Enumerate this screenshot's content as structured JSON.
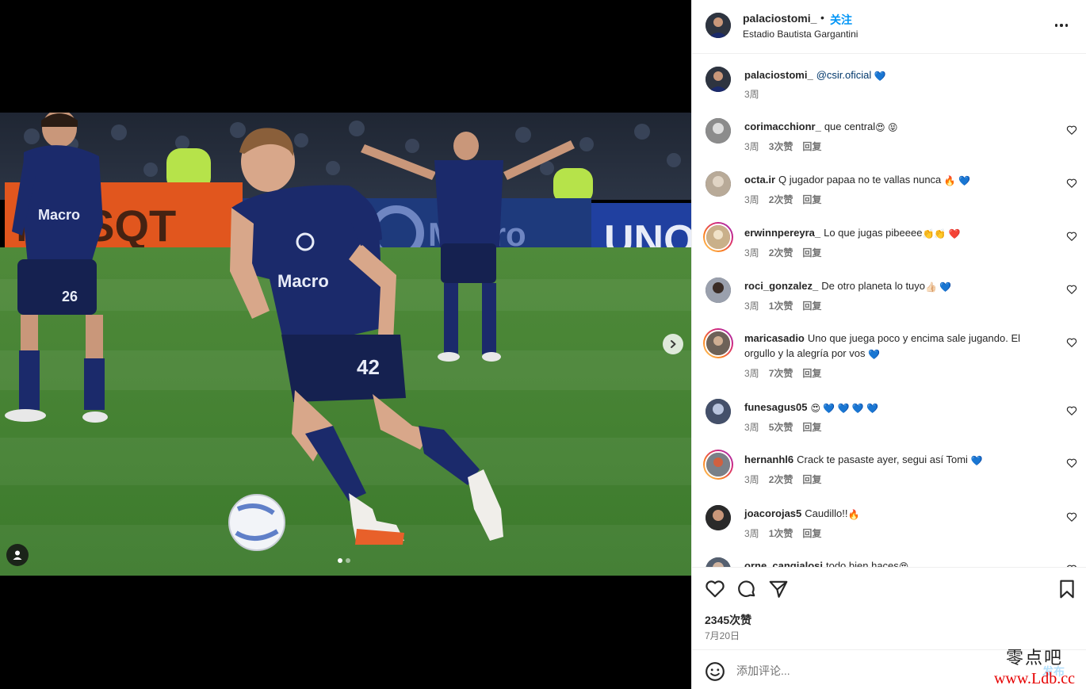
{
  "post": {
    "username": "palaciostomi_",
    "separator": "•",
    "follow_label": "关注",
    "location": "Estadio Bautista Gargantini",
    "more_label": "...",
    "jersey_number_left": "26",
    "jersey_number_main": "42",
    "sponsor_text": "Macro",
    "board_text_1": "MUSQT",
    "board_text_2": "UNO"
  },
  "caption": {
    "username": "palaciostomi_",
    "mention": "@csir.oficial",
    "emoji": "💙",
    "time": "3周"
  },
  "comments": [
    {
      "username": "corimacchionr_",
      "text": "que central",
      "emoji": "😍 😝",
      "time": "3周",
      "likes": "3次赞",
      "reply": "回复",
      "ring": false
    },
    {
      "username": "octa.ir",
      "text": "Q jugador papaa no te vallas nunca",
      "emoji": "🔥 💙",
      "time": "3周",
      "likes": "2次赞",
      "reply": "回复",
      "ring": false
    },
    {
      "username": "erwinnpereyra_",
      "text": "Lo que jugas pibeeee",
      "emoji": "👏👏 ❤️",
      "time": "3周",
      "likes": "2次赞",
      "reply": "回复",
      "ring": true
    },
    {
      "username": "roci_gonzalez_",
      "text": "De otro planeta lo tuyo",
      "emoji": "👍🏻 💙",
      "time": "3周",
      "likes": "1次赞",
      "reply": "回复",
      "ring": false
    },
    {
      "username": "maricasadio",
      "text": "Uno que juega poco y encima sale jugando. El orgullo y la alegría por vos",
      "emoji": "💙",
      "time": "3周",
      "likes": "7次赞",
      "reply": "回复",
      "ring": true
    },
    {
      "username": "funesagus05",
      "text": "",
      "emoji": "😍 💙 💙 💙 💙",
      "time": "3周",
      "likes": "5次赞",
      "reply": "回复",
      "ring": false
    },
    {
      "username": "hernanhl6",
      "text": "Crack te pasaste ayer, segui así Tomi",
      "emoji": "💙",
      "time": "3周",
      "likes": "2次赞",
      "reply": "回复",
      "ring": true
    },
    {
      "username": "joacorojas5",
      "text": "Caudillo!!",
      "emoji": "🔥",
      "time": "3周",
      "likes": "1次赞",
      "reply": "回复",
      "ring": false
    },
    {
      "username": "orne_cangialosi",
      "text": "todo bien haces",
      "emoji": "😍",
      "time": "",
      "likes": "",
      "reply": "",
      "ring": false
    }
  ],
  "actions": {
    "like_count": "2345次赞",
    "date": "7月20日"
  },
  "add_comment": {
    "placeholder": "添加评论...",
    "post_label": "发布"
  },
  "watermark": {
    "title": "零点吧",
    "url": "www.Ldb.cc"
  },
  "colors": {
    "accent": "#0095f6",
    "text": "#262626",
    "muted": "#737373",
    "jersey": "#1b2a6b"
  },
  "icons": [
    "more-icon",
    "heart-icon",
    "comment-icon",
    "share-icon",
    "bookmark-icon",
    "emoji-icon",
    "next-arrow-icon",
    "tag-user-icon"
  ]
}
